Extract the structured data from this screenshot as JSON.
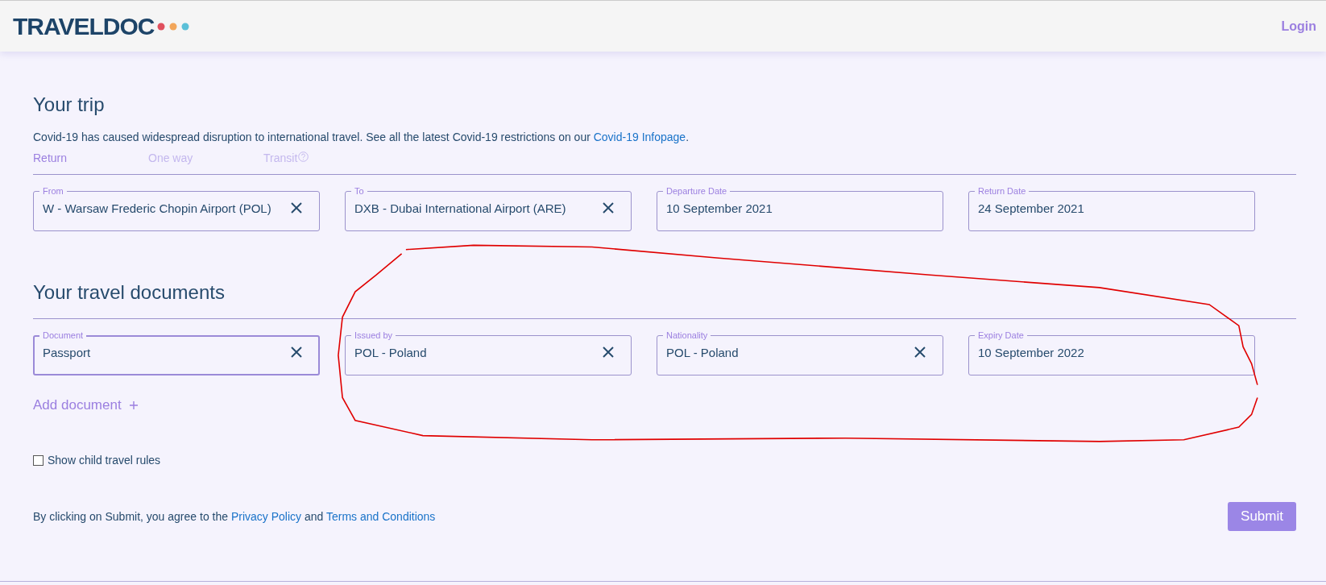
{
  "header": {
    "logo": "TRAVELDOC",
    "login": "Login"
  },
  "trip": {
    "title": "Your trip",
    "notice": "Covid-19 has caused widespread disruption to international travel. See all the latest Covid-19 restrictions on our ",
    "notice_link": "Covid-19 Infopage",
    "notice_end": ".",
    "tabs": [
      {
        "label": "Return",
        "selected": true,
        "help": false
      },
      {
        "label": "One way",
        "selected": false,
        "help": false
      },
      {
        "label": "Transit",
        "selected": false,
        "help": true
      }
    ],
    "fields": [
      {
        "label": "From",
        "value": "W - Warsaw Frederic Chopin Airport (POL)",
        "clearable": true,
        "focused": false
      },
      {
        "label": "To",
        "value": "DXB - Dubai International Airport (ARE)",
        "clearable": true,
        "focused": false
      },
      {
        "label": "Departure Date",
        "value": "10 September 2021",
        "clearable": false,
        "focused": false
      },
      {
        "label": "Return Date",
        "value": "24 September 2021",
        "clearable": false,
        "focused": false
      }
    ]
  },
  "documents": {
    "title": "Your travel documents",
    "fields": [
      {
        "label": "Document",
        "value": "Passport",
        "clearable": true,
        "focused": true
      },
      {
        "label": "Issued by",
        "value": "POL - Poland",
        "clearable": true,
        "focused": false
      },
      {
        "label": "Nationality",
        "value": "POL - Poland",
        "clearable": true,
        "focused": false
      },
      {
        "label": "Expiry Date",
        "value": "10 September 2022",
        "clearable": false,
        "focused": false
      }
    ],
    "add_label": "Add document"
  },
  "child_rules": {
    "label": "Show child travel rules",
    "checked": false
  },
  "consent": {
    "text": "By clicking on Submit, you agree to the ",
    "link_1": "Privacy Policy",
    "middle": " and ",
    "link_2": "Terms and Conditions"
  },
  "submit": "Submit"
}
